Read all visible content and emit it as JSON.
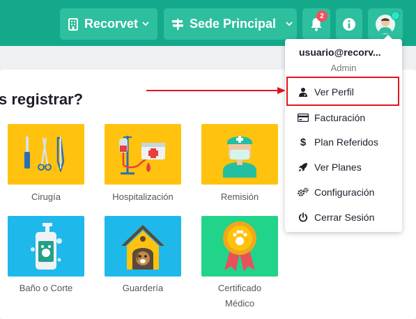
{
  "header": {
    "clinic_label": "Recorvet",
    "sede_label": "Sede Principal",
    "notification_count": "2"
  },
  "main": {
    "question": "s registrar?",
    "services": [
      {
        "label": "Cirugía"
      },
      {
        "label": "Hospitalización"
      },
      {
        "label": "Remisión"
      },
      {
        "label": "Baño o Corte"
      },
      {
        "label": "Guardería"
      },
      {
        "label_line1": "Certificado",
        "label_line2": "Médico"
      }
    ]
  },
  "user_menu": {
    "email": "usuario@recorv...",
    "role": "Admin",
    "items": [
      {
        "label": "Ver Perfil",
        "icon": "user-doctor-icon"
      },
      {
        "label": "Facturación",
        "icon": "credit-card-icon"
      },
      {
        "label": "Plan Referidos",
        "icon": "dollar-icon"
      },
      {
        "label": "Ver Planes",
        "icon": "rocket-icon"
      },
      {
        "label": "Configuración",
        "icon": "gears-icon"
      },
      {
        "label": "Cerrar Sesión",
        "icon": "power-icon"
      }
    ]
  },
  "colors": {
    "header_bg": "#14a98b",
    "pill_bg": "#2ebf9e",
    "tile_yellow": "#ffc20e",
    "tile_blue": "#1fb8ea",
    "tile_green": "#22d38a",
    "highlight": "#e0141b"
  }
}
